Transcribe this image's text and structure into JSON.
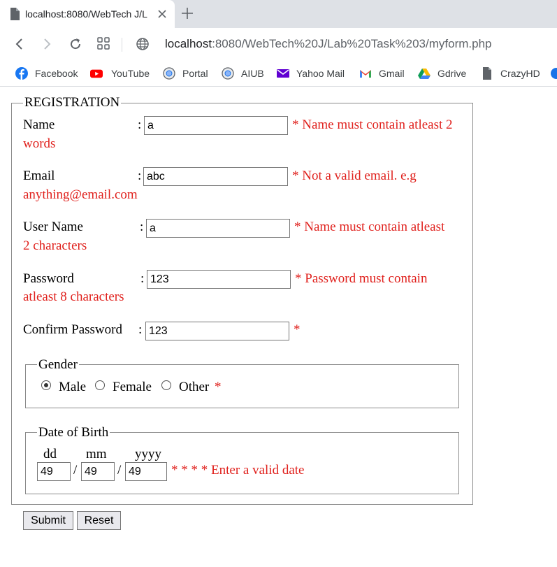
{
  "browser": {
    "tab_title": "localhost:8080/WebTech J/L",
    "url_host": "localhost",
    "url_path": ":8080/WebTech%20J/Lab%20Task%203/myform.php",
    "bookmarks": [
      {
        "label": "Facebook",
        "icon": "facebook-icon",
        "color": "#1877f2"
      },
      {
        "label": "YouTube",
        "icon": "youtube-icon",
        "color": "#ff0000"
      },
      {
        "label": "Portal",
        "icon": "globe-icon",
        "color": "#5f6368"
      },
      {
        "label": "AIUB",
        "icon": "globe-icon",
        "color": "#5f6368"
      },
      {
        "label": "Yahoo Mail",
        "icon": "yahoo-mail-icon",
        "color": "#6001d2"
      },
      {
        "label": "Gmail",
        "icon": "gmail-icon",
        "color": "#ea4335"
      },
      {
        "label": "Gdrive",
        "icon": "gdrive-icon",
        "color": "#0f9d58"
      },
      {
        "label": "CrazyHD",
        "icon": "page-icon",
        "color": "#5f6368"
      }
    ]
  },
  "form": {
    "legend": "REGISTRATION",
    "name": {
      "label": "Name",
      "colon": ":",
      "value": "a",
      "error_line1": "* Name must contain atleast 2",
      "error_line2": "words"
    },
    "email": {
      "label": "Email",
      "colon": ":",
      "value": "abc",
      "error_line1": "* Not a valid email. e.g",
      "error_line2": "anything@email.com"
    },
    "username": {
      "label": "User Name",
      "colon": ":",
      "value": "a",
      "error_line1": "* Name must contain atleast",
      "error_line2": "2 characters"
    },
    "password": {
      "label": "Password",
      "colon": ":",
      "value": "123",
      "error_line1": "* Password must contain",
      "error_line2": "atleast 8 characters"
    },
    "confirm_password": {
      "label": "Confirm Password",
      "colon": ":",
      "value": "123",
      "error": "*"
    },
    "gender": {
      "legend": "Gender",
      "options": [
        "Male",
        "Female",
        "Other"
      ],
      "selected": "Male",
      "error": "*"
    },
    "dob": {
      "legend": "Date of Birth",
      "dd_label": "dd",
      "mm_label": "mm",
      "yyyy_label": "yyyy",
      "separator": "/",
      "dd_value": "49",
      "mm_value": "49",
      "yyyy_value": "49",
      "error": "* * * * Enter a valid date"
    },
    "submit_label": "Submit",
    "reset_label": "Reset"
  },
  "colors": {
    "error": "#e0211d",
    "tabstrip": "#dee1e6"
  }
}
